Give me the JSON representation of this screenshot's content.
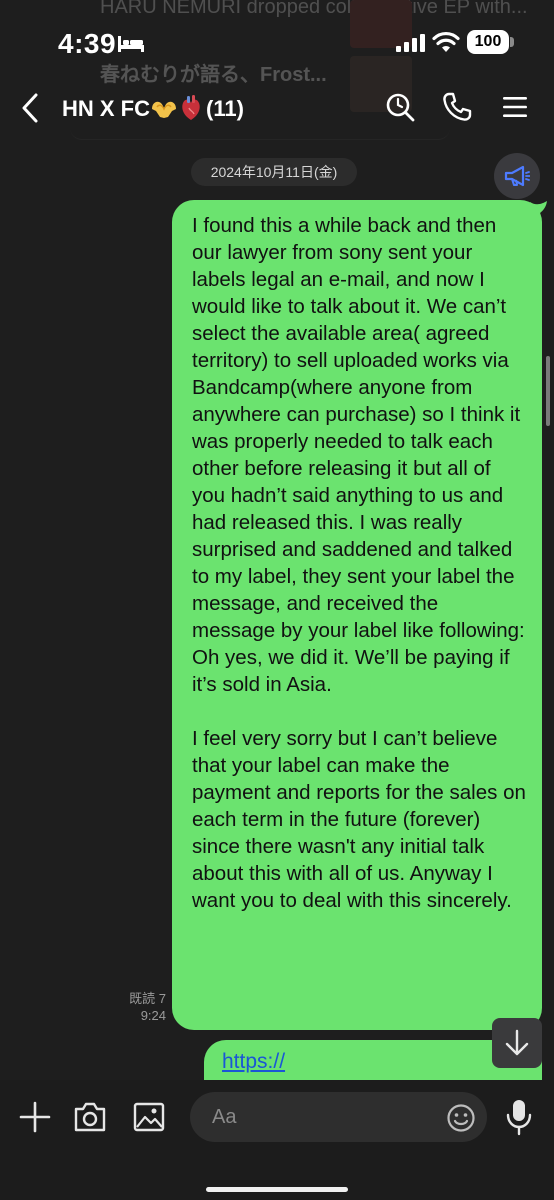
{
  "status_bar": {
    "time": "4:39",
    "battery": "100"
  },
  "background_preview": {
    "line1": "HARU NEMURI dropped collaborative EP with...",
    "line2": "春ねむりが語る、Frost..."
  },
  "header": {
    "title": "HN X FC",
    "member_count": "(11)"
  },
  "date_separator": "2024年10月11日(金)",
  "messages": [
    {
      "sender": "me",
      "paragraphs": [
        "I found this a while back and then our lawyer from sony sent your labels legal an e-mail, and now I would like to talk about it. We can’t select the available area( agreed territory) to sell uploaded works via Bandcamp(where anyone from anywhere can purchase) so I think it was properly needed to talk each other before releasing it but all of you hadn’t said anything to us and had released this. I was really surprised and saddened and talked to my label, they sent your label the message, and received the message by your label like following: Oh yes, we did it. We’ll be paying if it’s sold in Asia.",
        "I feel very sorry but I can’t believe that your label can make the payment and reports for the sales on each term in the future (forever) since there wasn't any initial talk about this with all of us. Anyway I want you to deal with this sincerely."
      ],
      "read_label": "既読 7",
      "time": "9:24"
    },
    {
      "sender": "me",
      "link_text": "https://"
    }
  ],
  "input": {
    "placeholder": "Aa"
  },
  "colors": {
    "bubble": "#6be36f",
    "background": "#1e1e1e",
    "link": "#1a56d6",
    "megaphone_accent": "#4d7bff"
  }
}
